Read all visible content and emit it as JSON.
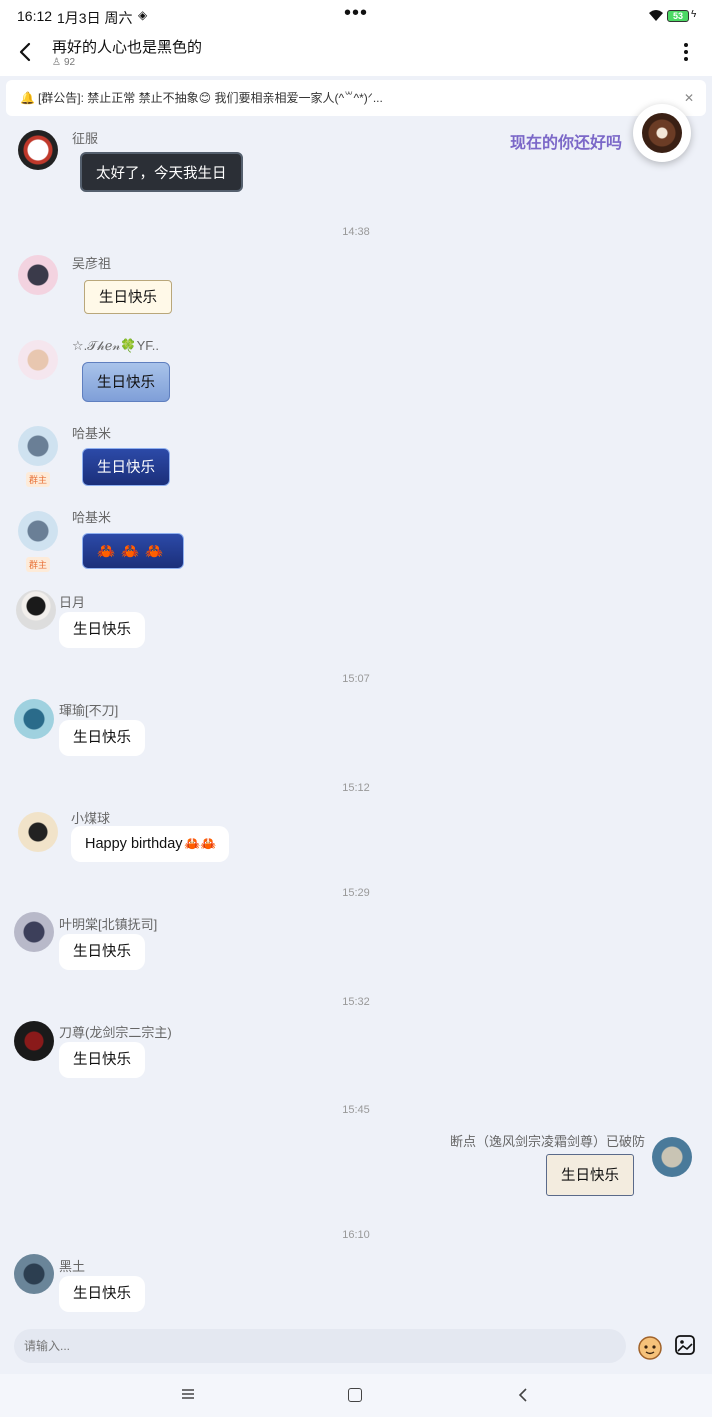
{
  "status_bar": {
    "time": "16:12",
    "date": "1月3日 周六",
    "dots": "•••",
    "battery": "53"
  },
  "header": {
    "title": "再好的人心也是黑色的",
    "member_count": "92"
  },
  "announcement": {
    "text": "[群公告]: 禁止正常 禁止不抽象😊 我们要相亲相爱一家人(^꒳^*)ᐟ..."
  },
  "music": {
    "label": "现在的你还好吗"
  },
  "owner_badge": "群主",
  "messages": [
    {
      "sender": "征服",
      "text": "太好了，今天我生日"
    },
    {
      "time": "14:38"
    },
    {
      "sender": "吴彦祖",
      "text": "生日快乐"
    },
    {
      "sender": "☆.𝒯𝒽ℯ𝓃🍀YF..",
      "text": "生日快乐"
    },
    {
      "sender": "哈基米",
      "text": "生日快乐"
    },
    {
      "sender": "哈基米",
      "text": "🦀🦀🦀"
    },
    {
      "sender": "日月",
      "text": "生日快乐"
    },
    {
      "time": "15:07"
    },
    {
      "sender": "琿瑜[不刀]",
      "text": "生日快乐"
    },
    {
      "time": "15:12"
    },
    {
      "sender": "小煤球",
      "text": "Happy birthday"
    },
    {
      "time": "15:29"
    },
    {
      "sender": "叶明棠[北镇抚司]",
      "text": "生日快乐"
    },
    {
      "time": "15:32"
    },
    {
      "sender": "刀尊(龙剑宗二宗主)",
      "text": "生日快乐"
    },
    {
      "time": "15:45"
    },
    {
      "sender": "断点（逸风剑宗凌霜剑尊）已破防",
      "text": "生日快乐"
    },
    {
      "time": "16:10"
    },
    {
      "sender": "黑土",
      "text": "生日快乐"
    }
  ],
  "input": {
    "placeholder": "请输入..."
  },
  "colors": {
    "background": "#eef1f8",
    "accent": "#7b68c8",
    "owner_badge": "#e8733a"
  },
  "icons": [
    "back-arrow-icon",
    "more-vertical-icon",
    "bell-icon",
    "close-icon",
    "emoji-icon",
    "image-icon",
    "menu-icon",
    "home-icon",
    "nav-back-icon"
  ]
}
